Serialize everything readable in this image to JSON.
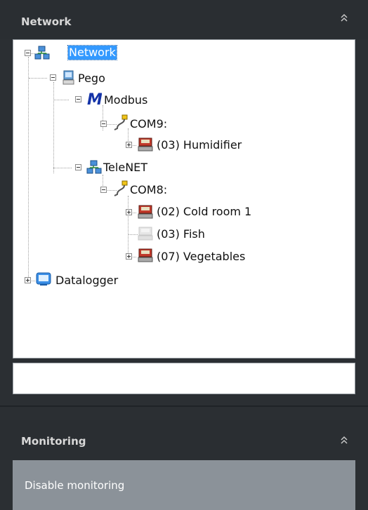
{
  "network_panel": {
    "title": "Network",
    "collapse_icon": "double-chevron-up-icon"
  },
  "tree": {
    "root": {
      "label": "Network",
      "icon": "network-icon",
      "expanded": true,
      "selected": true
    },
    "pego": {
      "label": "Pego",
      "icon": "computer-icon",
      "expanded": true
    },
    "modbus": {
      "label": "Modbus",
      "icon": "modbus-m-icon",
      "expanded": true
    },
    "com9": {
      "label": "COM9:",
      "icon": "serial-cable-icon",
      "expanded": true
    },
    "humidifier": {
      "label": "(03) Humidifier",
      "icon": "device-controller-icon",
      "expanded": false
    },
    "telenet": {
      "label": "TeleNET",
      "icon": "network-icon",
      "expanded": true
    },
    "com8": {
      "label": "COM8:",
      "icon": "serial-cable-icon",
      "expanded": true
    },
    "cold_room": {
      "label": "(02) Cold room 1",
      "icon": "device-controller-icon",
      "expanded": false
    },
    "fish": {
      "label": "(03) Fish",
      "icon": "device-controller-disabled-icon"
    },
    "vegetables": {
      "label": "(07) Vegetables",
      "icon": "device-controller-icon",
      "expanded": false
    },
    "datalogger": {
      "label": "Datalogger",
      "icon": "datalogger-icon",
      "expanded": false
    }
  },
  "filter_input": {
    "value": "",
    "placeholder": ""
  },
  "monitoring_panel": {
    "title": "Monitoring",
    "collapse_icon": "double-chevron-up-icon",
    "button_label": "Disable monitoring"
  },
  "colors": {
    "panel_bg": "#2b2f33",
    "selection": "#3399ff",
    "button_bg": "#8b9299"
  }
}
